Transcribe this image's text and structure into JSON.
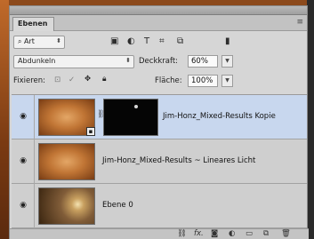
{
  "panel": {
    "tab_label": "Ebenen",
    "menu_icon": "panel-menu-icon"
  },
  "filter": {
    "kind_label": "Art",
    "kind_icon": "search-icon"
  },
  "filter_icons": [
    "image-filter-icon",
    "adjustment-filter-icon",
    "type-filter-icon",
    "shape-filter-icon",
    "smart-object-filter-icon",
    "filter-toggle-icon"
  ],
  "blend": {
    "mode": "Abdunkeln",
    "opacity_label": "Deckkraft:",
    "opacity_value": "60%"
  },
  "lock": {
    "label": "Fixieren:",
    "icons": [
      "lock-transparent-icon",
      "lock-paint-icon",
      "lock-position-icon",
      "lock-all-icon"
    ],
    "fill_label": "Fläche:",
    "fill_value": "100%"
  },
  "layers": [
    {
      "name": "Jim-Honz_Mixed-Results Kopie",
      "visible": true,
      "selected": true,
      "has_mask": true
    },
    {
      "name": "Jim-Honz_Mixed-Results ~ Lineares Licht",
      "visible": true,
      "selected": false,
      "has_mask": false
    },
    {
      "name": "Ebene 0",
      "visible": true,
      "selected": false,
      "has_mask": false
    }
  ],
  "bottom_icons": [
    "link-layers-icon",
    "fx-icon",
    "add-mask-icon",
    "adjustment-layer-icon",
    "group-icon",
    "new-layer-icon",
    "trash-icon"
  ],
  "glyphs": {
    "fx": "fx.",
    "filter_toggle": "▮"
  }
}
